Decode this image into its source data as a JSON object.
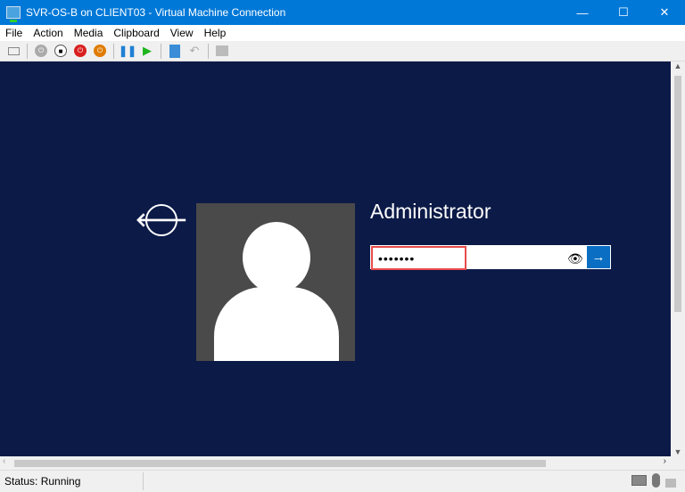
{
  "window": {
    "title": "SVR-OS-B on CLIENT03 - Virtual Machine Connection",
    "minimize": "—",
    "maximize": "☐",
    "close": "✕"
  },
  "menu": [
    "File",
    "Action",
    "Media",
    "Clipboard",
    "View",
    "Help"
  ],
  "toolbar": [
    "ctrl-alt-del",
    "start",
    "turn-off",
    "shut-down",
    "save",
    "pause",
    "resume",
    "checkpoint",
    "revert",
    "enhanced-session"
  ],
  "login": {
    "back_glyph": "🡐",
    "username": "Administrator",
    "password_masked": "•••••••",
    "eye_glyph": "👁",
    "submit_glyph": "→"
  },
  "status": {
    "text": "Status: Running"
  },
  "colors": {
    "titlebar": "#0078d7",
    "screen": "#0b1a47",
    "submit": "#0a6ec2",
    "highlight": "#e84b4b"
  }
}
